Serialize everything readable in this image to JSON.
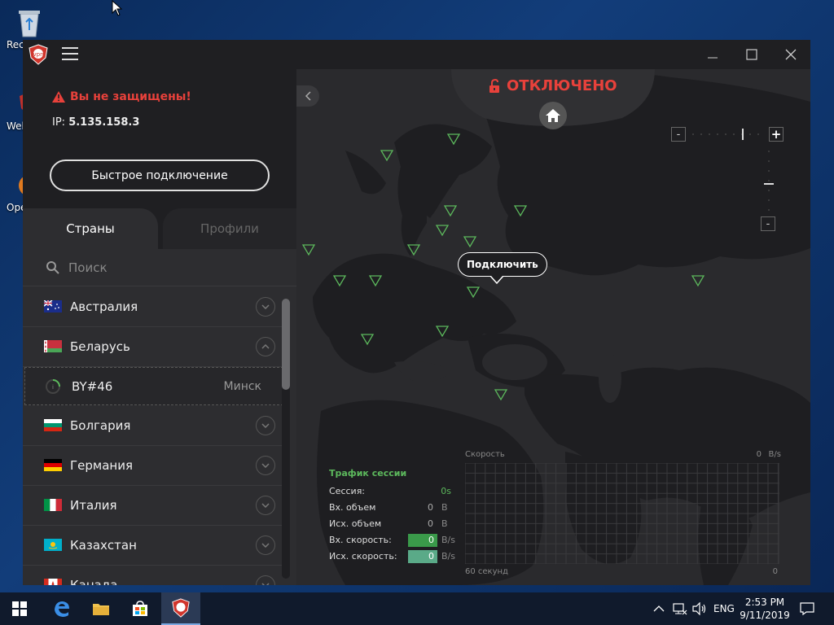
{
  "desktop": {
    "icons": [
      {
        "label": "Rec"
      },
      {
        "label": "Web"
      },
      {
        "label": "Oper"
      }
    ]
  },
  "app": {
    "titlebar": {
      "minimize": "—",
      "maximize": "☐",
      "close": "✕"
    },
    "status_panel": {
      "warning": "Вы не защищены!",
      "ip_label": "IP:",
      "ip_value": "5.135.158.3",
      "quick_connect": "Быстрое подключение"
    },
    "tabs": {
      "countries": "Страны",
      "profiles": "Профили"
    },
    "search": {
      "placeholder": "Поиск"
    },
    "countries": [
      {
        "name": "Австралия",
        "flag": "au",
        "expanded": false
      },
      {
        "name": "Беларусь",
        "flag": "by",
        "expanded": true
      },
      {
        "name": "Болгария",
        "flag": "bg",
        "expanded": false
      },
      {
        "name": "Германия",
        "flag": "de",
        "expanded": false
      },
      {
        "name": "Италия",
        "flag": "it",
        "expanded": false
      },
      {
        "name": "Казахстан",
        "flag": "kz",
        "expanded": false
      },
      {
        "name": "Канада",
        "flag": "ca",
        "expanded": false
      }
    ],
    "server": {
      "name": "BY#46",
      "city": "Минск"
    },
    "map": {
      "status": "ОТКЛЮЧЕНО",
      "tooltip": "Подключить",
      "zoom_minus": "-",
      "zoom_plus": "+",
      "zoom_down": "-"
    },
    "stats": {
      "title": "Трафик сессии",
      "session_label": "Сессия:",
      "session_value": "0s",
      "in_volume_label": "Вх. объем",
      "in_volume_value": "0",
      "in_volume_unit": "B",
      "out_volume_label": "Исх. объем",
      "out_volume_value": "0",
      "out_volume_unit": "B",
      "in_speed_label": "Вх. скорость:",
      "in_speed_value": "0",
      "in_speed_unit": "B/s",
      "out_speed_label": "Исх. скорость:",
      "out_speed_value": "0",
      "out_speed_unit": "B/s"
    },
    "graph": {
      "speed_label": "Скорость",
      "speed_value": "0",
      "speed_unit": "B/s",
      "x_left": "60 секунд",
      "x_right": "0"
    },
    "colors": {
      "danger": "#e8413b",
      "accent_green": "#5cb85c",
      "in_speed_box": "#3a9a4a",
      "out_speed_box": "#5aaa88"
    }
  },
  "taskbar": {
    "language": "ENG",
    "time": "2:53 PM",
    "date": "9/11/2019"
  }
}
